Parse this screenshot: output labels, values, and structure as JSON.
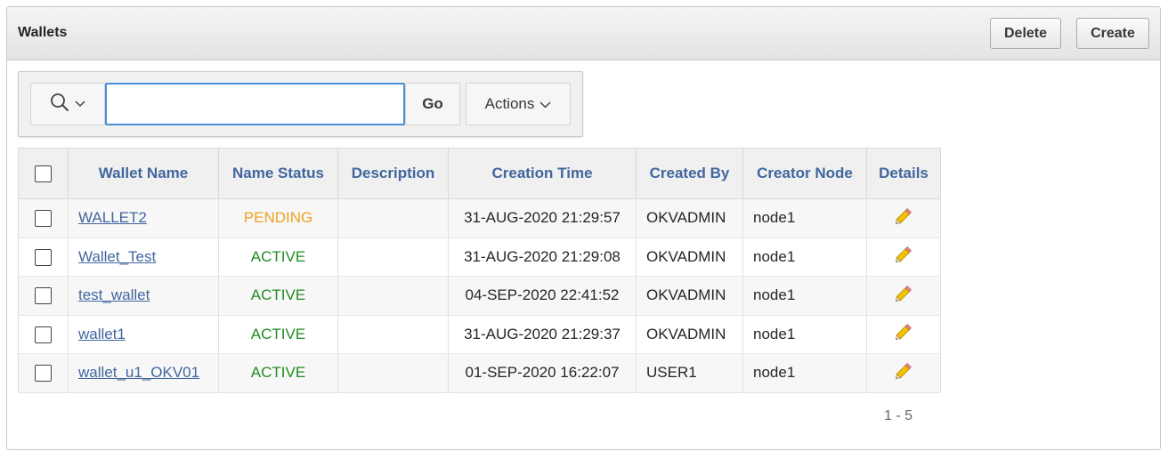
{
  "header": {
    "title": "Wallets",
    "delete_label": "Delete",
    "create_label": "Create"
  },
  "toolbar": {
    "search_icon": "search-icon",
    "search_value": "",
    "go_label": "Go",
    "actions_label": "Actions"
  },
  "table": {
    "columns": [
      "Wallet Name",
      "Name Status",
      "Description",
      "Creation Time",
      "Created By",
      "Creator Node",
      "Details"
    ],
    "rows": [
      {
        "name": "WALLET2",
        "status": "PENDING",
        "description": "",
        "time": "31-AUG-2020 21:29:57",
        "by": "OKVADMIN",
        "node": "node1"
      },
      {
        "name": "Wallet_Test",
        "status": "ACTIVE",
        "description": "",
        "time": "31-AUG-2020 21:29:08",
        "by": "OKVADMIN",
        "node": "node1"
      },
      {
        "name": "test_wallet",
        "status": "ACTIVE",
        "description": "",
        "time": "04-SEP-2020 22:41:52",
        "by": "OKVADMIN",
        "node": "node1"
      },
      {
        "name": "wallet1",
        "status": "ACTIVE",
        "description": "",
        "time": "31-AUG-2020 21:29:37",
        "by": "OKVADMIN",
        "node": "node1"
      },
      {
        "name": "wallet_u1_OKV01",
        "status": "ACTIVE",
        "description": "",
        "time": "01-SEP-2020 16:22:07",
        "by": "USER1",
        "node": "node1"
      }
    ]
  },
  "pagination": {
    "range": "1 - 5"
  },
  "colors": {
    "pending": "#f0a020",
    "active": "#228b22",
    "header_text": "#41669e",
    "focus_border": "#4a90d9"
  }
}
